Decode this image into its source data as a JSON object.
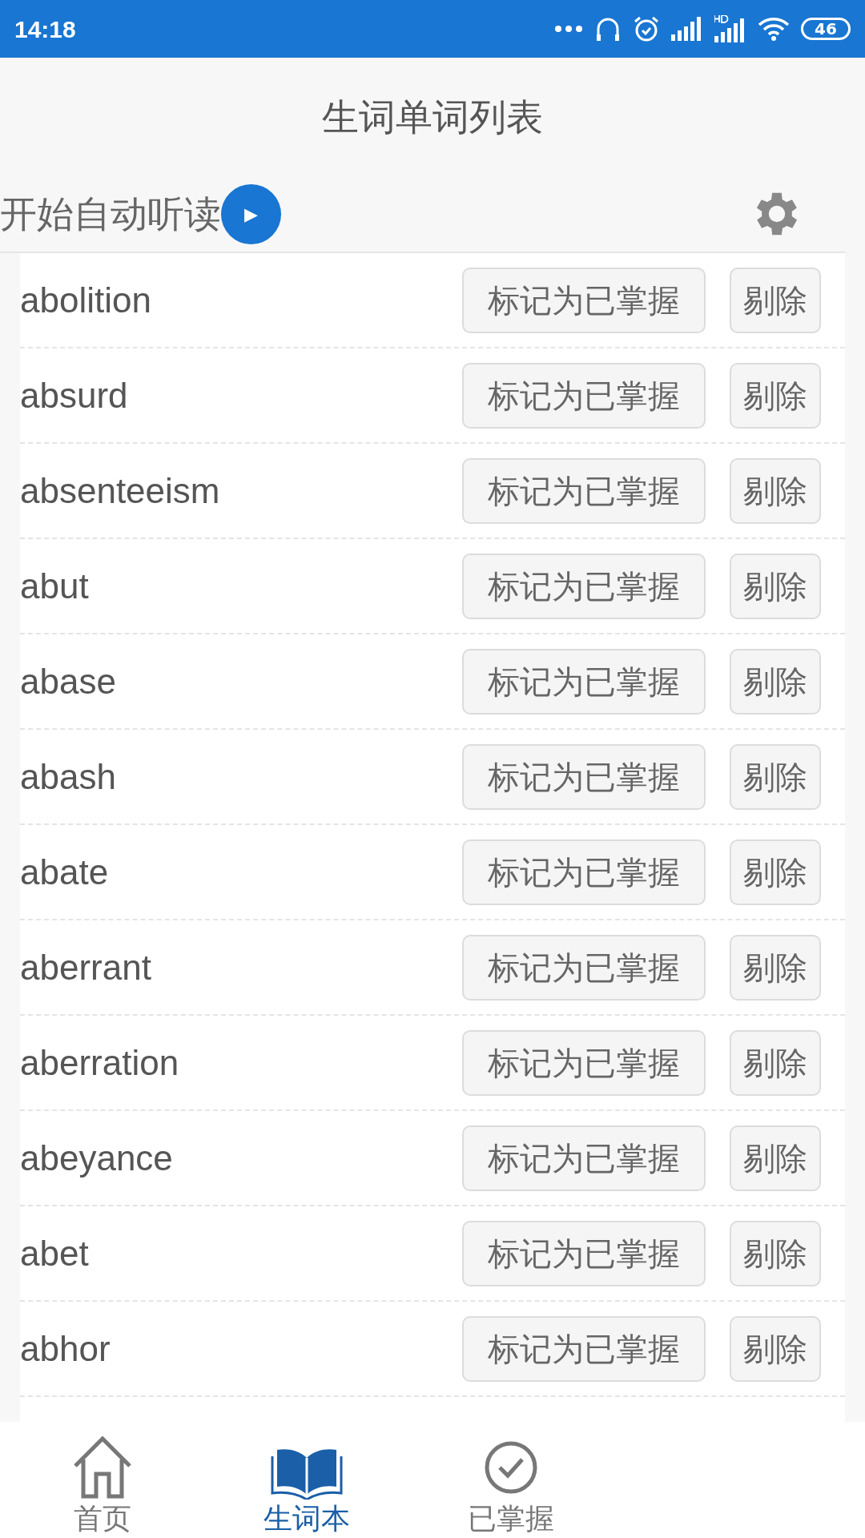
{
  "status_bar": {
    "time": "14:18",
    "battery": "46"
  },
  "header": {
    "title": "生词单词列表"
  },
  "toolbar": {
    "auto_read_label": "开始自动听读",
    "play_symbol": "▶"
  },
  "words": [
    {
      "word": "abolition",
      "mark_button": "标记为已掌握",
      "remove_button": "剔除"
    },
    {
      "word": "absurd",
      "mark_button": "标记为已掌握",
      "remove_button": "剔除"
    },
    {
      "word": "absenteeism",
      "mark_button": "标记为已掌握",
      "remove_button": "剔除"
    },
    {
      "word": "abut",
      "mark_button": "标记为已掌握",
      "remove_button": "剔除"
    },
    {
      "word": "abase",
      "mark_button": "标记为已掌握",
      "remove_button": "剔除"
    },
    {
      "word": "abash",
      "mark_button": "标记为已掌握",
      "remove_button": "剔除"
    },
    {
      "word": "abate",
      "mark_button": "标记为已掌握",
      "remove_button": "剔除"
    },
    {
      "word": "aberrant",
      "mark_button": "标记为已掌握",
      "remove_button": "剔除"
    },
    {
      "word": "aberration",
      "mark_button": "标记为已掌握",
      "remove_button": "剔除"
    },
    {
      "word": "abeyance",
      "mark_button": "标记为已掌握",
      "remove_button": "剔除"
    },
    {
      "word": "abet",
      "mark_button": "标记为已掌握",
      "remove_button": "剔除"
    },
    {
      "word": "abhor",
      "mark_button": "标记为已掌握",
      "remove_button": "剔除"
    }
  ],
  "bottom_nav": [
    {
      "kind": "home",
      "label": "首页",
      "selected": false
    },
    {
      "kind": "book",
      "label": "生词本",
      "selected": true
    },
    {
      "kind": "check",
      "label": "已掌握",
      "selected": false
    }
  ]
}
